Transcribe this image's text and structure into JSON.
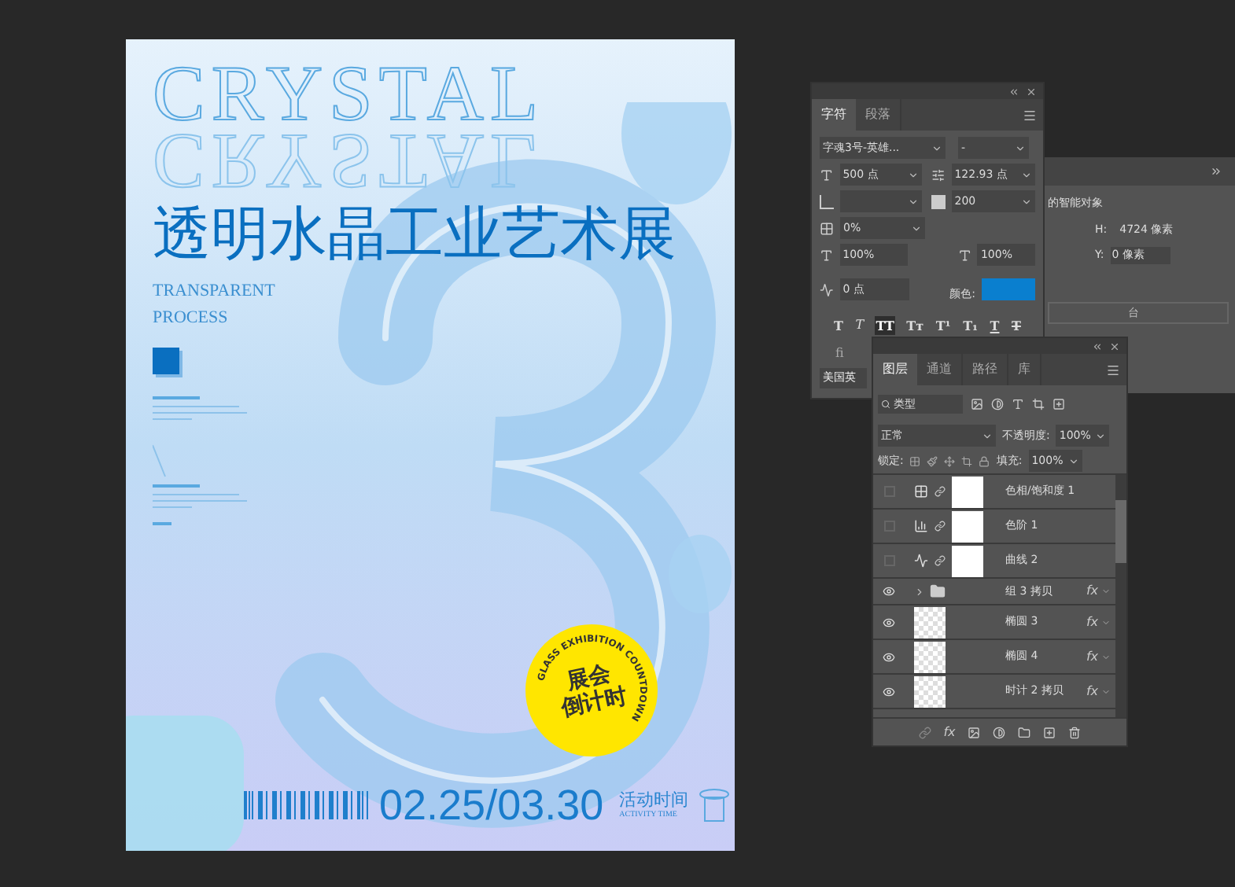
{
  "poster": {
    "outline_title": "CRYSTAL",
    "reflection": "CRYSTAL",
    "title": "透明水晶工业艺术展",
    "subtitle_lines": [
      "TRANSPARENT",
      "PROCESS"
    ],
    "badge": {
      "ring_text": "GLASS EXHIBITION COUNTDOWN",
      "lines": [
        "展会",
        "倒计时"
      ]
    },
    "date": "02.25/03.30",
    "time_label": "活动时间",
    "time_label_en": "ACTIVITY TIME"
  },
  "character_panel": {
    "tabs": [
      {
        "label": "字符",
        "selected": true
      },
      {
        "label": "段落",
        "selected": false
      }
    ],
    "font_family": "字魂3号-英雄...",
    "font_style": "-",
    "size": "500 点",
    "leading": "122.93 点",
    "tracking": "200",
    "tsume": "0%",
    "vertical_scale": "100%",
    "horizontal_scale": "100%",
    "baseline_shift": "0 点",
    "color_label": "颜色:",
    "color": "#0a7fcf",
    "style_buttons": [
      {
        "glyph": "T",
        "kind": "bold",
        "selected": false
      },
      {
        "glyph": "T",
        "kind": "italic",
        "selected": false
      },
      {
        "glyph": "TT",
        "kind": "caps",
        "selected": true
      },
      {
        "glyph": "Tт",
        "kind": "smallcaps",
        "selected": false
      },
      {
        "glyph": "T¹",
        "kind": "super",
        "selected": false
      },
      {
        "glyph": "T₁",
        "kind": "sub",
        "selected": false
      },
      {
        "glyph": "T",
        "kind": "underline",
        "selected": false
      },
      {
        "glyph": "T",
        "kind": "strike",
        "selected": false
      }
    ],
    "ligature": "fi",
    "language": "美国英"
  },
  "properties_panel": {
    "object_label": "的智能对象",
    "h_label": "H:",
    "h_value": "4724 像素",
    "y_label": "Y:",
    "y_value": "0 像素",
    "dropdown_text": "台"
  },
  "layers_panel": {
    "tabs": [
      {
        "label": "图层",
        "selected": true
      },
      {
        "label": "通道",
        "selected": false
      },
      {
        "label": "路径",
        "selected": false
      },
      {
        "label": "库",
        "selected": false
      }
    ],
    "add_style_label": "fx",
    "filter": "类型",
    "blend_mode": "正常",
    "opacity_label": "不透明度:",
    "opacity": "100%",
    "lock_label": "锁定:",
    "fill_label": "填充:",
    "fill": "100%",
    "layers": [
      {
        "name": "色相/饱和度 1",
        "kind": "hue",
        "visible": false
      },
      {
        "name": "色阶 1",
        "kind": "levels",
        "visible": false
      },
      {
        "name": "曲线 2",
        "kind": "curves",
        "visible": false
      },
      {
        "name": "组 3 拷贝",
        "kind": "group",
        "visible": true,
        "fx": "fx"
      },
      {
        "name": "椭圆 3",
        "kind": "smart",
        "visible": true,
        "fx": "fx"
      },
      {
        "name": "椭圆 4",
        "kind": "smart",
        "visible": true,
        "fx": "fx"
      },
      {
        "name": "时计 2 拷贝",
        "kind": "smart",
        "visible": true,
        "fx": "fx"
      }
    ]
  }
}
